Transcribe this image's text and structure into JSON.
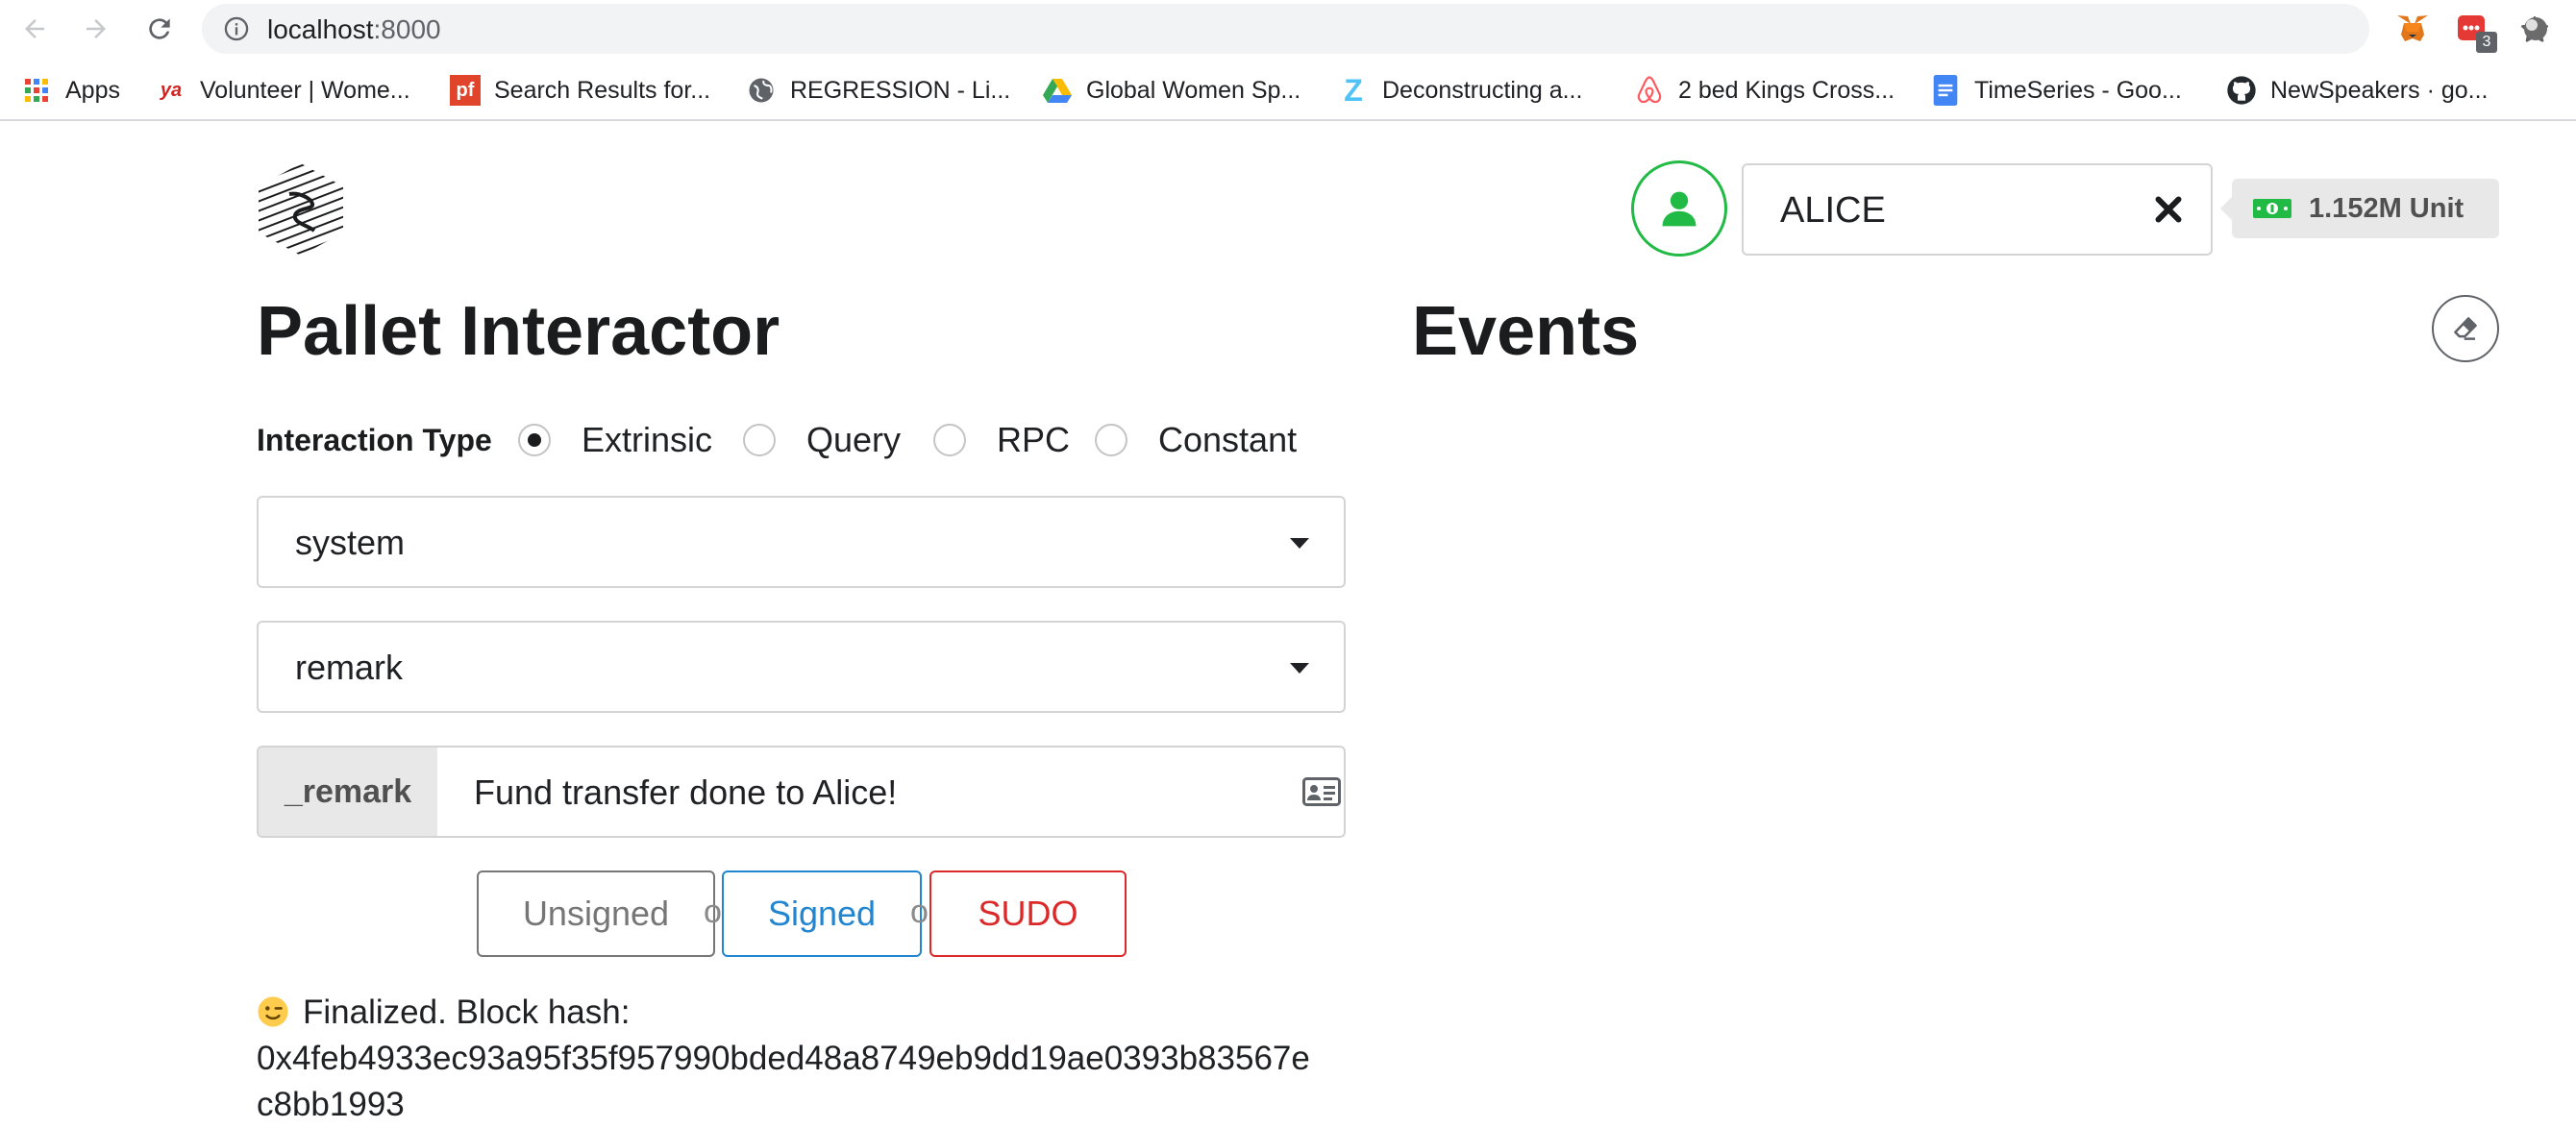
{
  "browser": {
    "url_host": "localhost",
    "url_port": ":8000",
    "ext_badge": "3",
    "bookmarks": [
      {
        "label": "Apps"
      },
      {
        "label": "Volunteer | Wome..."
      },
      {
        "label": "Search Results for..."
      },
      {
        "label": "REGRESSION - Li..."
      },
      {
        "label": "Global Women Sp..."
      },
      {
        "label": "Deconstructing a..."
      },
      {
        "label": "2 bed Kings Cross..."
      },
      {
        "label": "TimeSeries - Goo..."
      },
      {
        "label": "NewSpeakers · go..."
      }
    ],
    "bookmark_icon_text": {
      "yelp": "ya",
      "pf": "pf",
      "zoho": "Z"
    }
  },
  "header": {
    "account_name": "ALICE",
    "balance": "1.152M Unit"
  },
  "pallet_interactor": {
    "title": "Pallet Interactor",
    "interaction_type_label": "Interaction Type",
    "interaction_types": [
      "Extrinsic",
      "Query",
      "RPC",
      "Constant"
    ],
    "selected_type": "Extrinsic",
    "pallet": "system",
    "callable": "remark",
    "param_name": "_remark",
    "param_value": "Fund transfer done to Alice!",
    "buttons": {
      "unsigned": "Unsigned",
      "signed": "Signed",
      "sudo": "SUDO"
    },
    "or_text": "or",
    "status_line1": "Finalized. Block hash:",
    "status_line2": "0x4feb4933ec93a95f35f957990bded48a8749eb9dd19ae0393b83567e",
    "status_line3": "c8bb1993"
  },
  "events": {
    "title": "Events"
  },
  "colors": {
    "green": "#21ba45",
    "blue": "#2185d0",
    "red": "#db2828"
  }
}
